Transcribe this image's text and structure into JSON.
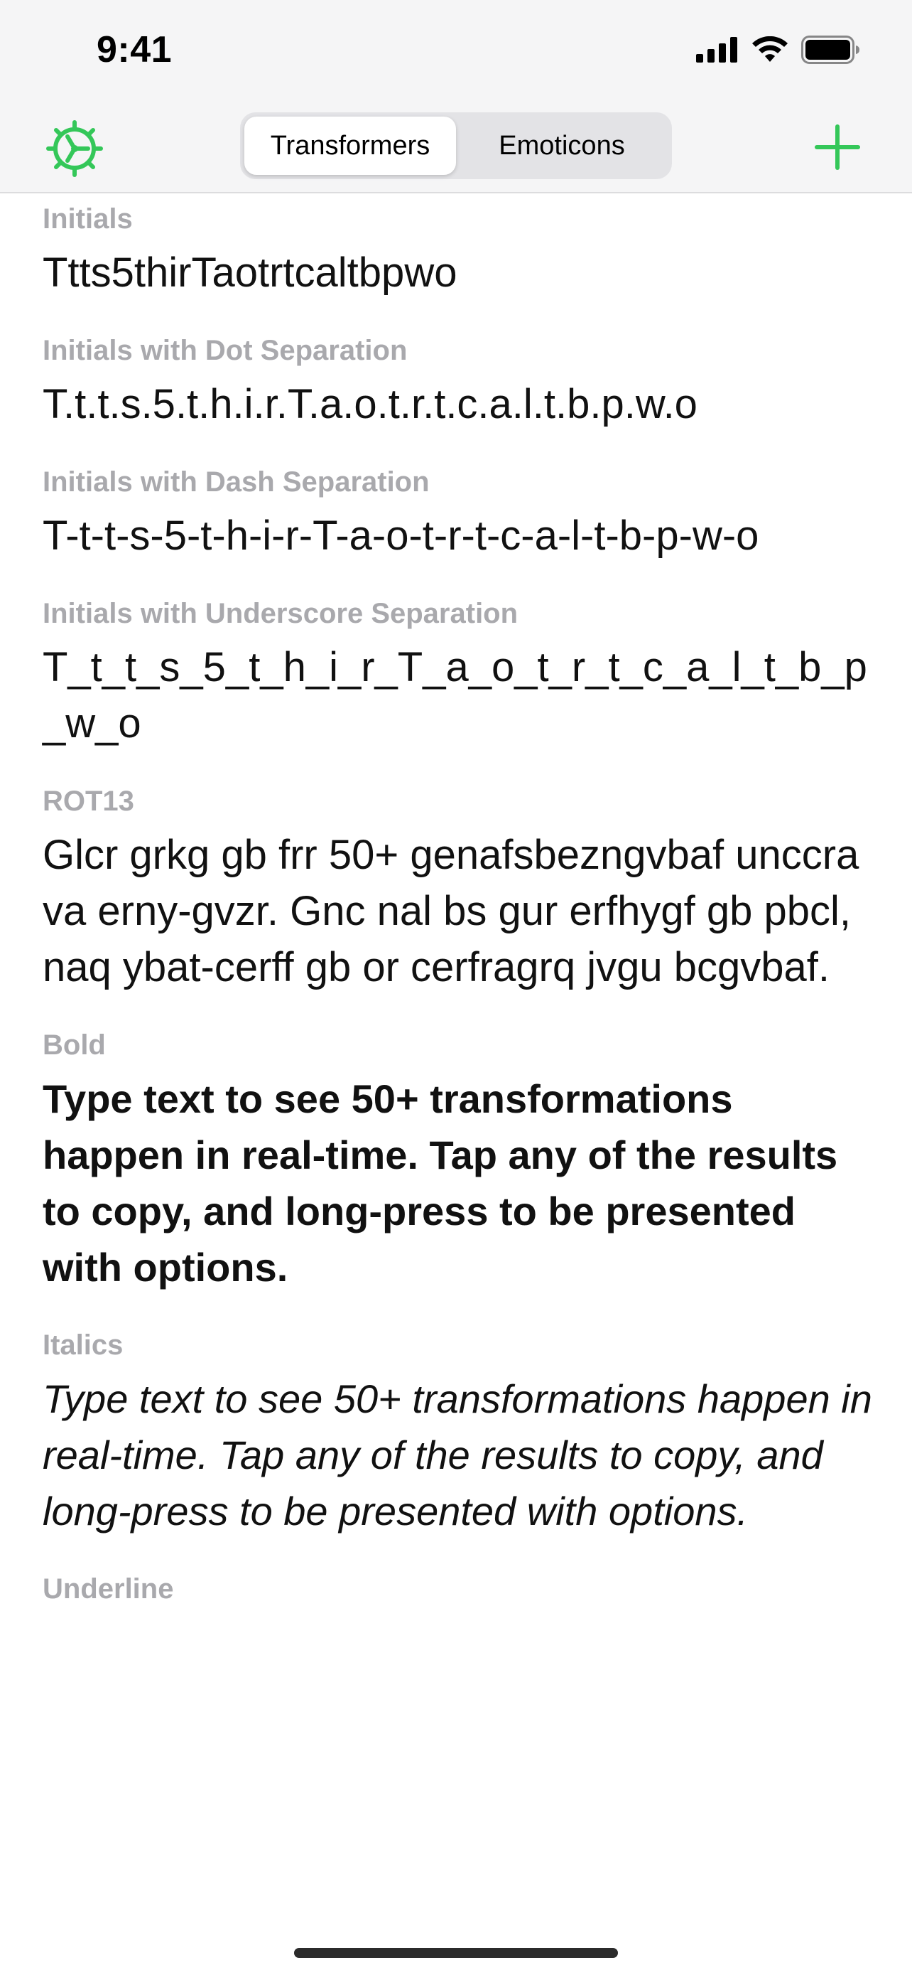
{
  "status_bar": {
    "time": "9:41",
    "signal_icon": "cellular-signal-icon",
    "wifi_icon": "wifi-icon",
    "battery_icon": "battery-full-icon"
  },
  "nav": {
    "settings_icon": "gear-icon",
    "tabs": [
      {
        "label": "Transformers",
        "selected": true
      },
      {
        "label": "Emoticons",
        "selected": false
      }
    ],
    "add_icon": "plus-icon",
    "accent_color": "#34c759"
  },
  "results": [
    {
      "label": "Initials",
      "value": "Ttts5thirTaotrtcaltbpwo",
      "style": "plain"
    },
    {
      "label": "Initials with Dot Separation",
      "value": "T.t.t.s.5.t.h.i.r.T.a.o.t.r.t.c.a.l.t.b.p.w.o",
      "style": "plain"
    },
    {
      "label": "Initials with Dash Separation",
      "value": "T-t-t-s-5-t-h-i-r-T-a-o-t-r-t-c-a-l-t-b-p-w-o",
      "style": "plain"
    },
    {
      "label": "Initials with Underscore Separation",
      "value": "T_t_t_s_5_t_h_i_r_T_a_o_t_r_t_c_a_l_t_b_p_w_o",
      "style": "plain"
    },
    {
      "label": "ROT13",
      "value": "Glcr grkg gb frr 50+ genafsbezngvbaf unccra va erny-gvzr. Gnc nal bs gur erfhygf gb pbcl, naq ybat-cerff gb or cerfragrq jvgu bcgvbaf.",
      "style": "words"
    },
    {
      "label": "Bold",
      "value": "Type text to see 50+ transformations happen in real-time. Tap any of the results to copy, and long-press to be presented with options.",
      "style": "bold"
    },
    {
      "label": "Italics",
      "value": "Type text to see 50+ transformations happen in real-time. Tap any of the results to copy, and long-press to be presented with options.",
      "style": "italic"
    },
    {
      "label": "Underline",
      "value": "",
      "style": "plain"
    }
  ]
}
